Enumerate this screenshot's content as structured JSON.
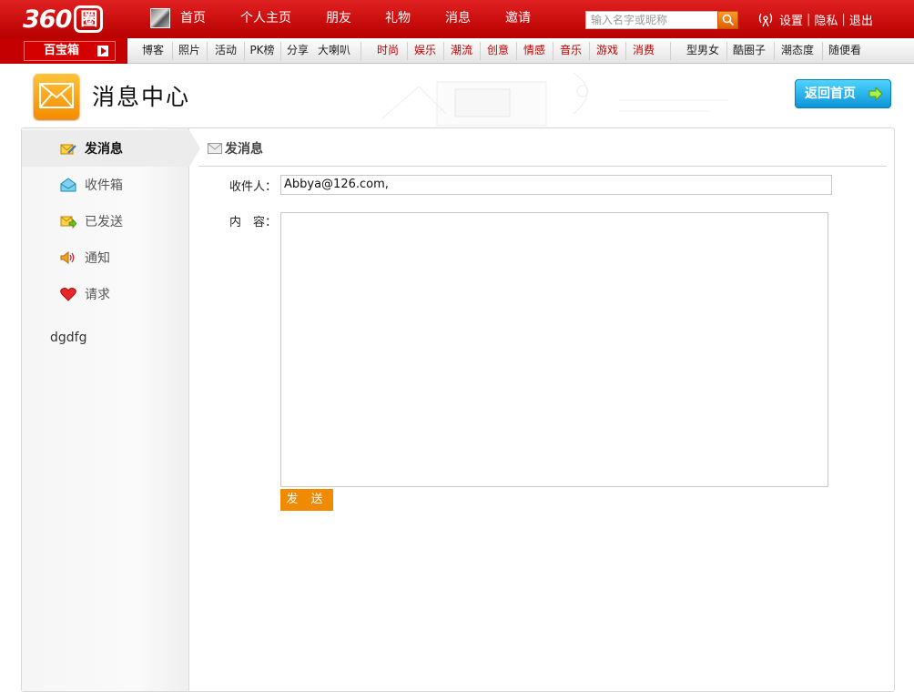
{
  "topbar": {
    "logo_text": "360",
    "logo_char": "圈",
    "nav": [
      "首页",
      "个人主页",
      "朋友",
      "礼物",
      "消息",
      "邀请"
    ],
    "search_placeholder": "输入名字或昵称",
    "settings": "设置",
    "privacy": "隐私",
    "logout": "退出"
  },
  "subbar": {
    "baobox": "百宝箱",
    "group1": [
      "博客",
      "照片",
      "活动",
      "PK榜",
      "分享",
      "大喇叭"
    ],
    "group2": [
      "时尚",
      "娱乐",
      "潮流",
      "创意",
      "情感",
      "音乐",
      "游戏",
      "消费"
    ],
    "group3": [
      "型男女",
      "酷圈子",
      "潮态度",
      "随便看"
    ]
  },
  "header": {
    "title": "消息中心",
    "home_button": "返回首页"
  },
  "sidebar": {
    "items": [
      {
        "label": "发消息",
        "icon": "compose-icon"
      },
      {
        "label": "收件箱",
        "icon": "inbox-icon"
      },
      {
        "label": "已发送",
        "icon": "sent-icon"
      },
      {
        "label": "通知",
        "icon": "speaker-icon"
      },
      {
        "label": "请求",
        "icon": "heart-icon"
      }
    ],
    "note": "dgdfg"
  },
  "compose": {
    "title": "发消息",
    "to_label": "收件人：",
    "to_value": "Abbya@126.com,",
    "body_label": "内　容：",
    "body_value": "",
    "send_label": "发 送"
  },
  "colors": {
    "top_red": "#c00000",
    "accent_orange": "#f08a00",
    "home_blue": "#1aa7e6"
  }
}
